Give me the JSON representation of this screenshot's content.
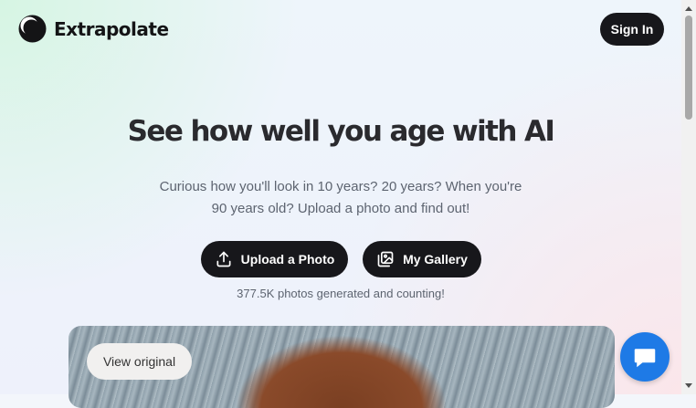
{
  "header": {
    "brand": "Extrapolate",
    "sign_in_label": "Sign In"
  },
  "hero": {
    "title": "See how well you age with AI",
    "subtitle": "Curious how you'll look in 10 years? 20 years? When you're 90 years old? Upload a photo and find out!",
    "upload_label": "Upload a Photo",
    "gallery_label": "My Gallery",
    "counter": "377.5K photos generated and counting!"
  },
  "preview": {
    "view_original_label": "View original"
  },
  "icons": {
    "logo": "crescent-moon-logo",
    "upload": "upload-icon",
    "gallery": "gallery-icon",
    "chat": "chat-bubble-icon"
  },
  "colors": {
    "button_bg": "#17171b",
    "chat_accent": "#1e7ae6"
  }
}
